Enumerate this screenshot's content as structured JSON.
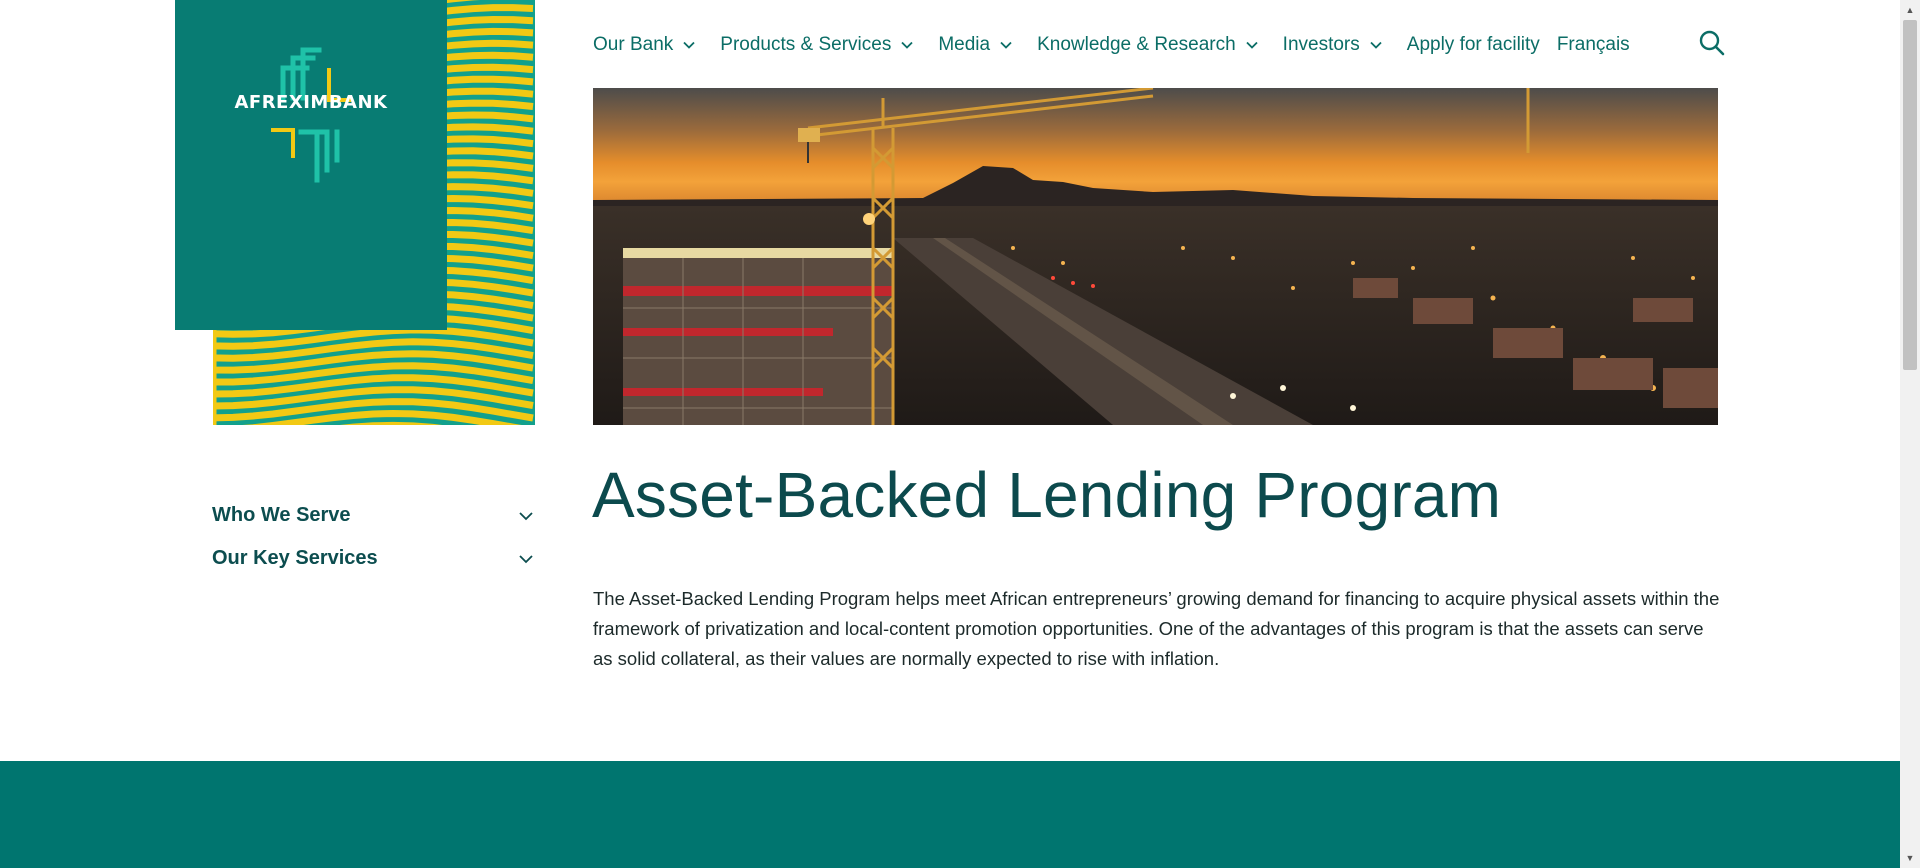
{
  "brand": {
    "name": "AFREXIMBANK",
    "colors": {
      "primary": "#087c73",
      "accent": "#f2c914",
      "wave_green": "#12a08c",
      "footer": "#00756f"
    }
  },
  "nav": {
    "items": [
      {
        "label": "Our Bank",
        "dropdown": true,
        "icon": "chevron-down-icon"
      },
      {
        "label": "Products & Services",
        "dropdown": true,
        "icon": "chevron-down-icon"
      },
      {
        "label": "Media",
        "dropdown": true,
        "icon": "chevron-down-icon"
      },
      {
        "label": "Knowledge & Research",
        "dropdown": true,
        "icon": "chevron-down-icon"
      },
      {
        "label": "Investors",
        "dropdown": true,
        "icon": "chevron-down-icon"
      },
      {
        "label": "Apply for facility",
        "dropdown": false
      },
      {
        "label": "Français",
        "dropdown": false
      }
    ],
    "search_icon": "search-icon"
  },
  "hero": {
    "image": "construction-site-city-sunset"
  },
  "sidebar": {
    "items": [
      {
        "label": "Who We Serve",
        "icon": "chevron-down-icon"
      },
      {
        "label": "Our Key Services",
        "icon": "chevron-down-icon"
      }
    ]
  },
  "main": {
    "title": "Asset-Backed Lending Program",
    "description": "The Asset-Backed Lending Program helps meet African entrepreneurs’ growing demand for financing to acquire physical assets within the framework of privatization and local-content promotion opportunities. One of the advantages of this program is that the assets can serve as solid collateral, as their values are normally expected to rise with inflation."
  }
}
